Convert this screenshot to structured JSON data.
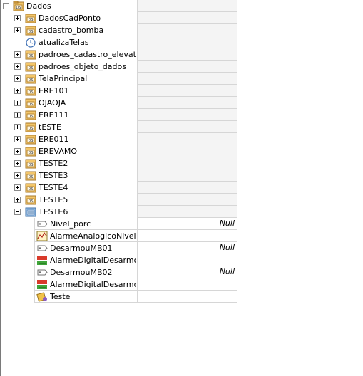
{
  "tree": {
    "root": {
      "label": "Dados",
      "expanded": true,
      "icon": "dataset-folder-icon"
    },
    "children": [
      {
        "label": "DadosCadPonto",
        "type": "dataset",
        "expanded": false
      },
      {
        "label": "cadastro_bomba",
        "type": "dataset",
        "expanded": false
      },
      {
        "label": "atualizaTelas",
        "type": "timer"
      },
      {
        "label": "padroes_cadastro_elevatori",
        "type": "dataset",
        "expanded": false
      },
      {
        "label": "padroes_objeto_dados",
        "type": "dataset",
        "expanded": false
      },
      {
        "label": "TelaPrincipal",
        "type": "dataset",
        "expanded": false
      },
      {
        "label": "ERE101",
        "type": "dataset",
        "expanded": false
      },
      {
        "label": "OJAOJA",
        "type": "dataset",
        "expanded": false
      },
      {
        "label": "ERE111",
        "type": "dataset",
        "expanded": false
      },
      {
        "label": "tESTE",
        "type": "dataset",
        "expanded": false
      },
      {
        "label": "ERE011",
        "type": "dataset",
        "expanded": false
      },
      {
        "label": "EREVAMO",
        "type": "dataset",
        "expanded": false
      },
      {
        "label": "TESTE2",
        "type": "dataset",
        "expanded": false
      },
      {
        "label": "TESTE3",
        "type": "dataset",
        "expanded": false
      },
      {
        "label": "TESTE4",
        "type": "dataset",
        "expanded": false
      },
      {
        "label": "TESTE5",
        "type": "dataset",
        "expanded": false
      },
      {
        "label": "TESTE6",
        "type": "dataset-open",
        "expanded": true
      }
    ],
    "teste6_children": [
      {
        "label": "Nivel_porc",
        "type": "tag",
        "value": "Null"
      },
      {
        "label": "AlarmeAnalogicoNivel_pc",
        "type": "analog-alarm",
        "value": ""
      },
      {
        "label": "DesarmouMB01",
        "type": "tag",
        "value": "Null"
      },
      {
        "label": "AlarmeDigitalDesarmouM",
        "type": "digital-alarm",
        "value": ""
      },
      {
        "label": "DesarmouMB02",
        "type": "tag",
        "value": "Null"
      },
      {
        "label": "AlarmeDigitalDesarmouM",
        "type": "digital-alarm",
        "value": ""
      },
      {
        "label": "Teste",
        "type": "script",
        "value": ""
      }
    ]
  }
}
